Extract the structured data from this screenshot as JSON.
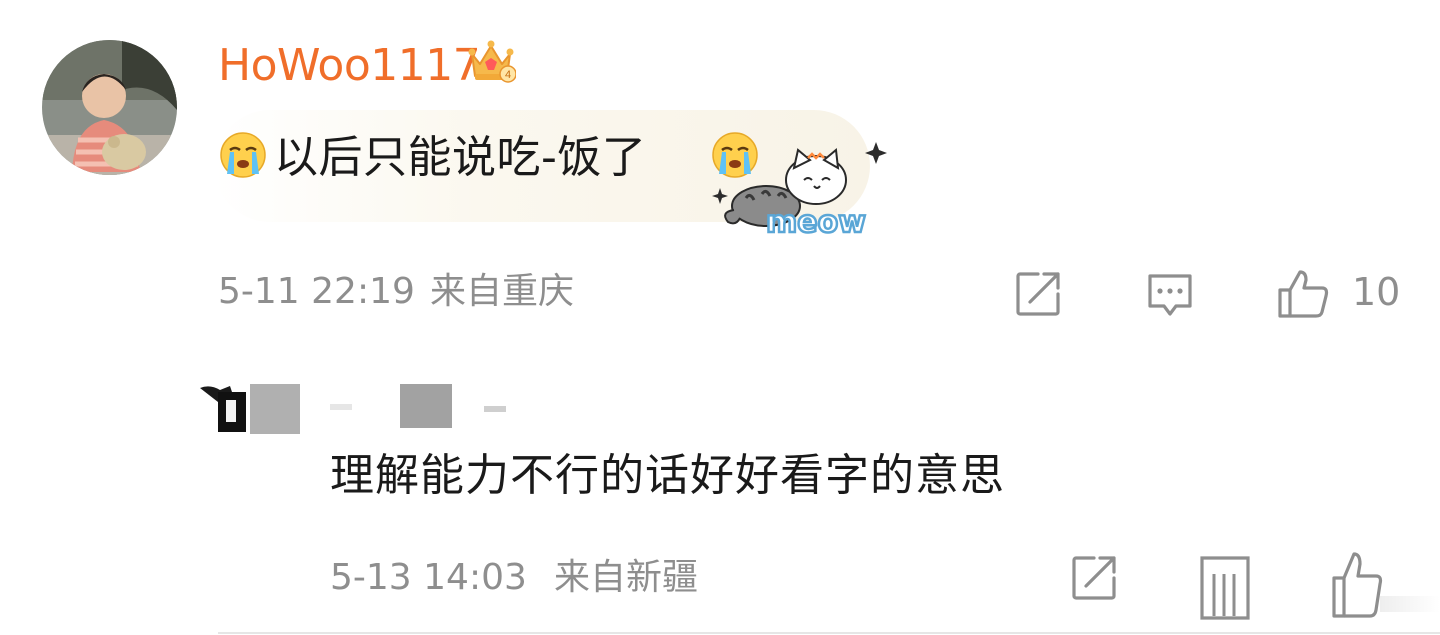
{
  "comment": {
    "username": "HoWoo1117",
    "badge_icon": "crown-badge-icon",
    "badge_level": "4",
    "text": "以后只能说吃-饭了",
    "leading_emoji": "crying-face-emoji",
    "trailing_emoji": "crying-face-emoji",
    "sticker_text": "meow",
    "time": "5-11 22:19",
    "location": "来自重庆",
    "actions": {
      "share_icon": "share-icon",
      "reply_icon": "comment-icon",
      "like_icon": "thumbs-up-icon",
      "like_count": "10"
    }
  },
  "reply": {
    "text": "理解能力不行的话好好看字的意思",
    "time": "5-13 14:03",
    "location": "来自新疆",
    "actions": {
      "share_icon": "share-icon",
      "reply_icon": "comment-icon",
      "like_icon": "thumbs-up-icon"
    }
  },
  "colors": {
    "username": "#f06e2a",
    "text": "#1a1a1a",
    "meta": "#8e8e8e"
  }
}
